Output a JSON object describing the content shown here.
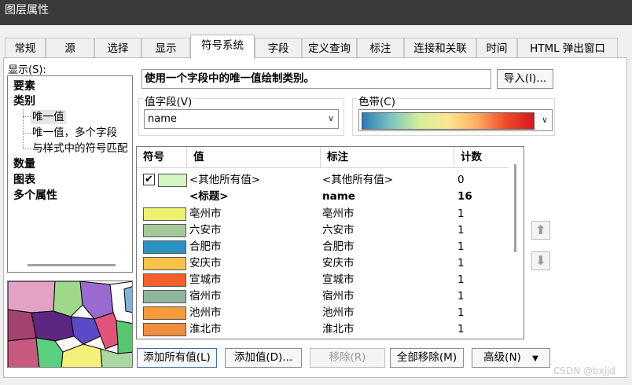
{
  "window": {
    "title": "图层属性"
  },
  "tabs": [
    "常规",
    "源",
    "选择",
    "显示",
    "符号系统",
    "字段",
    "定义查询",
    "标注",
    "连接和关联",
    "时间",
    "HTML 弹出窗口"
  ],
  "show_label": "显示(S):",
  "tree": {
    "features": "要素",
    "categories": "类别",
    "unique_values": "唯一值",
    "unique_values_many": "唯一值，多个字段",
    "match_style": "与样式中的符号匹配",
    "quantities": "数量",
    "charts": "图表",
    "multiple_attributes": "多个属性"
  },
  "description": "使用一个字段中的唯一值绘制类别。",
  "import_button": "导入(I)...",
  "value_field": {
    "label": "值字段(V)",
    "value": "name"
  },
  "color_ramp": {
    "label": "色带(C)",
    "colors": [
      "#2c7bb6",
      "#7cc4c0",
      "#d6ee9b",
      "#fee690",
      "#fdae61",
      "#f04b2a",
      "#d7191c"
    ]
  },
  "table": {
    "headers": {
      "symbol": "符号",
      "value": "值",
      "label": "标注",
      "count": "计数"
    },
    "other_row": {
      "value": "<其他所有值>",
      "label": "<其他所有值>",
      "count": "0",
      "swatch": "#d2f5c2",
      "checked": true
    },
    "heading_row": {
      "value": "<标题>",
      "label": "name",
      "count": "16"
    },
    "rows": [
      {
        "value": "亳州市",
        "label": "亳州市",
        "count": "1",
        "color": "#ecf26e"
      },
      {
        "value": "六安市",
        "label": "六安市",
        "count": "1",
        "color": "#a3c99b"
      },
      {
        "value": "合肥市",
        "label": "合肥市",
        "count": "1",
        "color": "#2b93c4"
      },
      {
        "value": "安庆市",
        "label": "安庆市",
        "count": "1",
        "color": "#f9c24a"
      },
      {
        "value": "宣城市",
        "label": "宣城市",
        "count": "1",
        "color": "#f46029"
      },
      {
        "value": "宿州市",
        "label": "宿州市",
        "count": "1",
        "color": "#8fb6a0"
      },
      {
        "value": "池州市",
        "label": "池州市",
        "count": "1",
        "color": "#f89a3a"
      },
      {
        "value": "淮北市",
        "label": "淮北市",
        "count": "1",
        "color": "#ef8e3e"
      }
    ]
  },
  "buttons": {
    "add_all": "添加所有值(L)",
    "add_values": "添加值(D)...",
    "remove": "移除(R)",
    "remove_all": "全部移除(M)",
    "advanced": "高级(N)"
  },
  "watermark": "CSDN @bxjjd"
}
